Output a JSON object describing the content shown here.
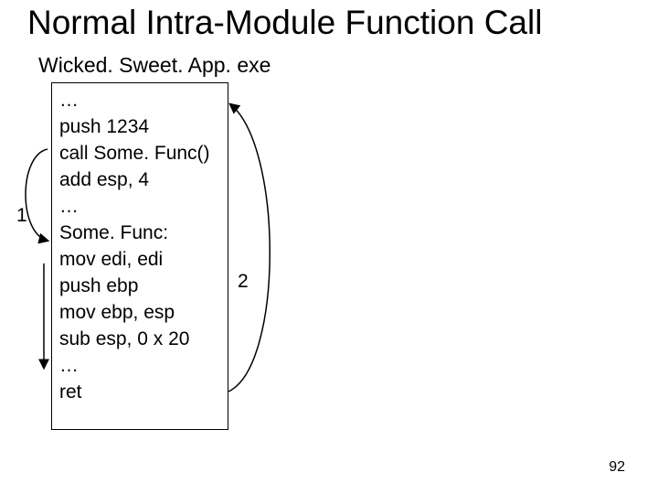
{
  "title": "Normal Intra-Module Function Call",
  "subtitle": "Wicked. Sweet. App. exe",
  "code": {
    "l0": "…",
    "l1": "push 1234",
    "l2": "call Some. Func()",
    "l3": "add esp, 4",
    "l4": "…",
    "l5": "Some. Func:",
    "l6": "mov edi, edi",
    "l7": "push ebp",
    "l8": "mov ebp, esp",
    "l9": "sub esp, 0 x 20",
    "l10": "…",
    "l11": "ret"
  },
  "labels": {
    "one": "1",
    "two": "2"
  },
  "page": "92"
}
